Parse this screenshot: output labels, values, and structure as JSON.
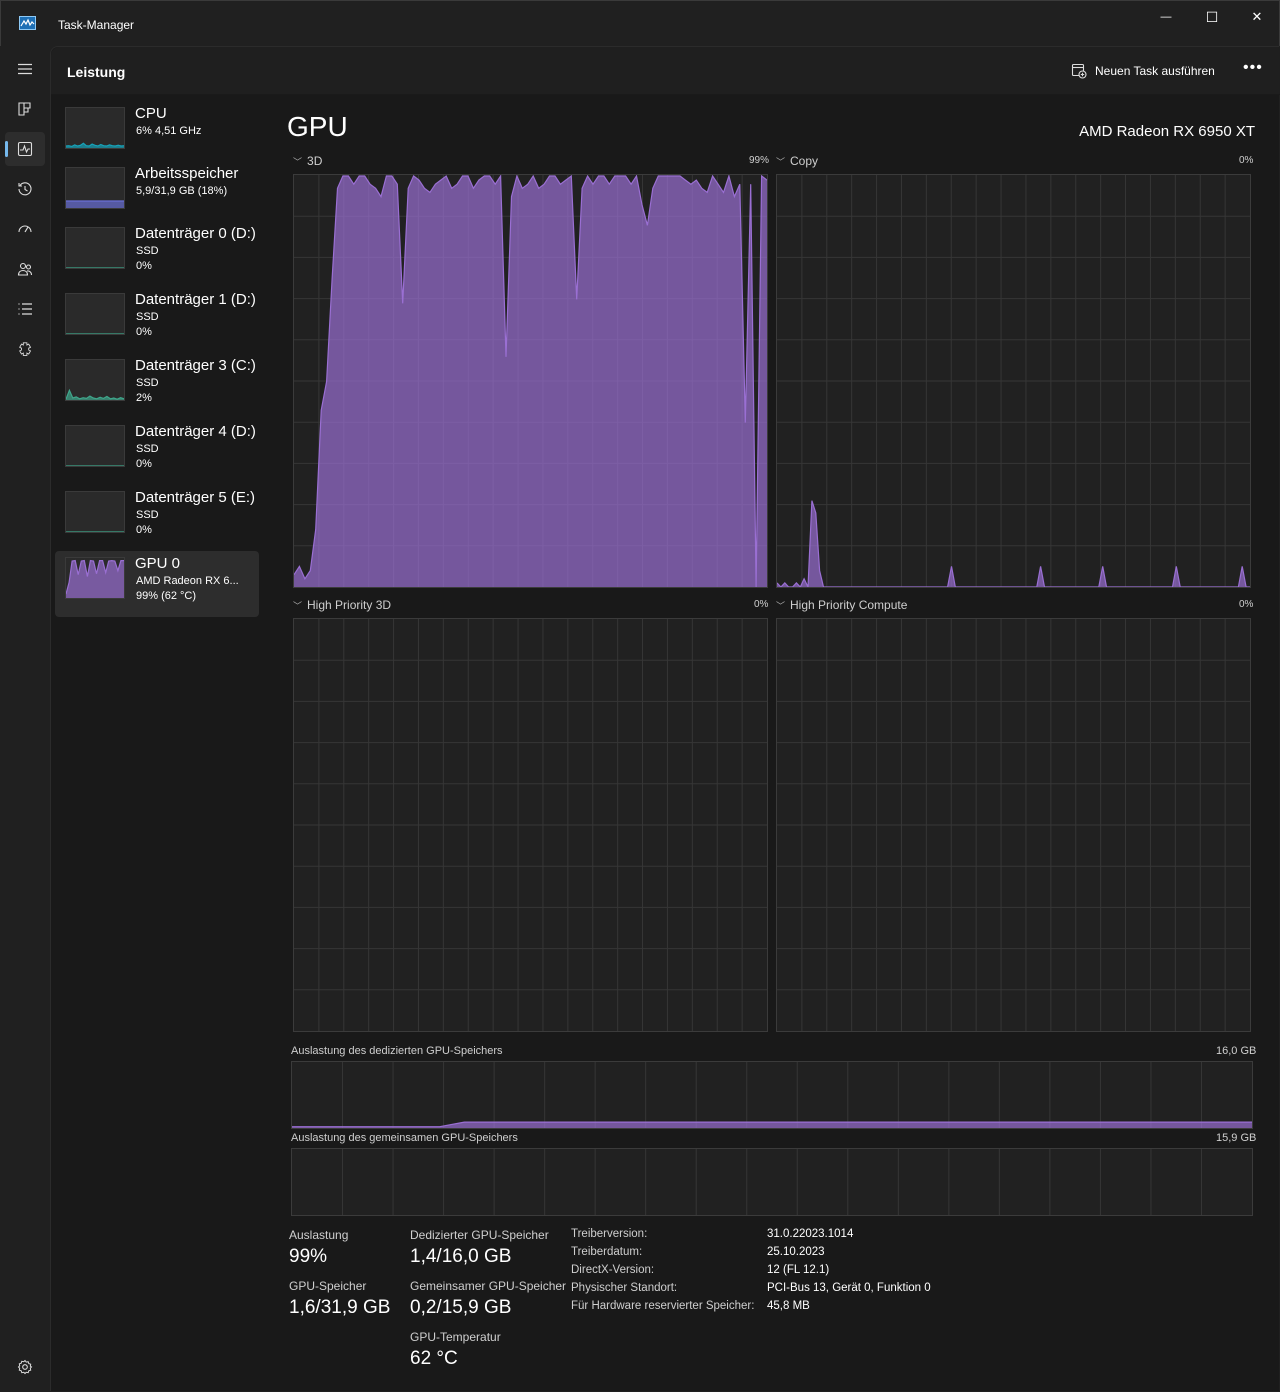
{
  "window": {
    "title": "Task-Manager",
    "minimize_glyph": "—",
    "maximize_glyph": "☐",
    "close_glyph": "✕"
  },
  "nav": {
    "items": [
      {
        "icon": "hamburger-menu-icon"
      },
      {
        "icon": "processes-icon"
      },
      {
        "icon": "performance-icon",
        "active": true
      },
      {
        "icon": "app-history-icon"
      },
      {
        "icon": "startup-apps-icon"
      },
      {
        "icon": "users-icon"
      },
      {
        "icon": "details-icon"
      },
      {
        "icon": "services-icon"
      }
    ],
    "settings_icon": "settings-gear-icon"
  },
  "header": {
    "title": "Leistung",
    "run_task_label": "Neuen Task ausführen",
    "more_label": "•••"
  },
  "devices": [
    {
      "name": "CPU",
      "line1": "6% 4,51 GHz",
      "line2": "",
      "color": "#17a2b8",
      "series": [
        0.05,
        0.06,
        0.04,
        0.08,
        0.05,
        0.07,
        0.12,
        0.06,
        0.05,
        0.1,
        0.07,
        0.05,
        0.09,
        0.06,
        0.05,
        0.08,
        0.06,
        0.05,
        0.07,
        0.05,
        0.06
      ]
    },
    {
      "name": "Arbeitsspeicher",
      "line1": "5,9/31,9 GB (18%)",
      "line2": "",
      "color": "#6a6fd6",
      "series": [
        0.18,
        0.18,
        0.18,
        0.18,
        0.18,
        0.18,
        0.18,
        0.18,
        0.18,
        0.18,
        0.18,
        0.18
      ]
    },
    {
      "name": "Datenträger 0 (D:)",
      "line1": "SSD",
      "line2": "0%",
      "color": "#3fa68b",
      "series": [
        0,
        0,
        0,
        0,
        0,
        0,
        0,
        0,
        0,
        0
      ]
    },
    {
      "name": "Datenträger 1 (D:)",
      "line1": "SSD",
      "line2": "0%",
      "color": "#3fa68b",
      "series": [
        0,
        0,
        0,
        0,
        0,
        0,
        0,
        0,
        0,
        0
      ]
    },
    {
      "name": "Datenträger 3 (C:)",
      "line1": "SSD",
      "line2": "2%",
      "color": "#3fa68b",
      "series": [
        0.02,
        0.25,
        0.05,
        0.08,
        0.03,
        0.06,
        0.04,
        0.1,
        0.05,
        0.03,
        0.07,
        0.04,
        0.09,
        0.03,
        0.05,
        0.02,
        0.06,
        0.03
      ]
    },
    {
      "name": "Datenträger 4 (D:)",
      "line1": "SSD",
      "line2": "0%",
      "color": "#3fa68b",
      "series": [
        0,
        0,
        0,
        0,
        0,
        0,
        0,
        0,
        0,
        0
      ]
    },
    {
      "name": "Datenträger 5 (E:)",
      "line1": "SSD",
      "line2": "0%",
      "color": "#3fa68b",
      "series": [
        0,
        0,
        0,
        0,
        0,
        0,
        0,
        0,
        0,
        0
      ]
    },
    {
      "name": "GPU 0",
      "line1": "AMD Radeon RX 6...",
      "line2": "99% (62 °C)",
      "color": "#9a6fd3",
      "selected": true,
      "series": [
        0.1,
        0.4,
        0.95,
        0.96,
        0.6,
        0.95,
        0.96,
        0.55,
        0.96,
        0.95,
        0.62,
        0.96,
        0.96,
        0.65,
        0.95,
        0.96,
        0.95,
        0.7,
        0.96,
        0.96
      ]
    }
  ],
  "gpu": {
    "title": "GPU",
    "model": "AMD Radeon RX 6950 XT",
    "accent": "#9a6fd3",
    "engines": [
      {
        "name": "3D",
        "percent": "99%",
        "series": [
          0.03,
          0.05,
          0.02,
          0.04,
          0.14,
          0.43,
          0.5,
          0.75,
          0.97,
          1.0,
          1.0,
          0.98,
          1.0,
          1.0,
          0.98,
          0.97,
          0.95,
          1.0,
          1.0,
          0.98,
          0.69,
          0.97,
          1.0,
          0.99,
          0.97,
          0.96,
          0.98,
          0.99,
          1.0,
          0.97,
          0.98,
          1.0,
          1.0,
          0.97,
          0.99,
          1.0,
          1.0,
          0.98,
          1.0,
          0.56,
          0.95,
          1.0,
          0.97,
          0.98,
          1.0,
          0.97,
          0.98,
          1.0,
          1.0,
          0.98,
          0.99,
          1.0,
          0.7,
          0.97,
          1.0,
          0.98,
          1.0,
          1.0,
          0.98,
          1.0,
          1.0,
          1.0,
          0.98,
          1.0,
          0.93,
          0.88,
          0.97,
          1.0,
          1.0,
          1.0,
          1.0,
          1.0,
          0.99,
          0.98,
          0.99,
          0.97,
          0.96,
          1.0,
          0.98,
          0.96,
          1.0,
          0.95,
          0.98,
          0.4,
          0.98,
          0.0,
          1.0,
          0.99
        ]
      },
      {
        "name": "Copy",
        "percent": "0%",
        "series": [
          0.01,
          0.0,
          0.01,
          0.0,
          0.0,
          0.01,
          0.0,
          0.02,
          0.0,
          0.21,
          0.18,
          0.04,
          0.0,
          0.0,
          0.0,
          0.0,
          0.0,
          0.0,
          0.0,
          0.0,
          0.0,
          0.0,
          0.0,
          0.0,
          0.0,
          0.0,
          0.0,
          0.0,
          0.0,
          0.0,
          0.0,
          0.0,
          0.0,
          0.0,
          0.0,
          0.0,
          0.0,
          0.0,
          0.0,
          0.0,
          0.0,
          0.0,
          0.0,
          0.0,
          0.0,
          0.05,
          0.0,
          0.0,
          0.0,
          0.0,
          0.0,
          0.0,
          0.0,
          0.0,
          0.0,
          0.0,
          0.0,
          0.0,
          0.0,
          0.0,
          0.0,
          0.0,
          0.0,
          0.0,
          0.0,
          0.0,
          0.0,
          0.0,
          0.05,
          0.0,
          0.0,
          0.0,
          0.0,
          0.0,
          0.0,
          0.0,
          0.0,
          0.0,
          0.0,
          0.0,
          0.0,
          0.0,
          0.0,
          0.0,
          0.05,
          0.0,
          0.0,
          0.0,
          0.0,
          0.0,
          0.0,
          0.0,
          0.0,
          0.0,
          0.0,
          0.0,
          0.0,
          0.0,
          0.0,
          0.0,
          0.0,
          0.0,
          0.0,
          0.05,
          0.0,
          0.0,
          0.0,
          0.0,
          0.0,
          0.0,
          0.0,
          0.0,
          0.0,
          0.0,
          0.0,
          0.0,
          0.0,
          0.0,
          0.0,
          0.0,
          0.05,
          0.0,
          0.0
        ]
      },
      {
        "name": "High Priority 3D",
        "percent": "0%",
        "series": []
      },
      {
        "name": "High Priority Compute",
        "percent": "0%",
        "series": []
      }
    ],
    "dedicated_mem": {
      "label": "Auslastung des dedizierten GPU-Speichers",
      "max": "16,0 GB",
      "series": [
        0.02,
        0.02,
        0.02,
        0.02,
        0.02,
        0.02,
        0.02,
        0.09,
        0.09,
        0.09,
        0.09,
        0.09,
        0.09,
        0.09,
        0.09,
        0.09,
        0.09,
        0.09,
        0.09,
        0.09,
        0.09,
        0.09,
        0.09,
        0.09,
        0.09,
        0.09,
        0.09,
        0.09,
        0.09,
        0.09,
        0.09,
        0.09,
        0.09,
        0.09,
        0.09,
        0.09,
        0.09,
        0.09,
        0.09,
        0.09
      ]
    },
    "shared_mem": {
      "label": "Auslastung des gemeinsamen GPU-Speichers",
      "max": "15,9 GB",
      "series": []
    },
    "stats": {
      "utilization_label": "Auslastung",
      "utilization_value": "99%",
      "dedicated_label": "Dedizierter GPU-Speicher",
      "dedicated_value": "1,4/16,0 GB",
      "gpu_mem_label": "GPU-Speicher",
      "gpu_mem_value": "1,6/31,9 GB",
      "shared_label": "Gemeinsamer GPU-Speicher",
      "shared_value": "0,2/15,9 GB",
      "temp_label": "GPU-Temperatur",
      "temp_value": "62 °C"
    },
    "info": [
      {
        "key": "Treiberversion:",
        "value": "31.0.22023.1014"
      },
      {
        "key": "Treiberdatum:",
        "value": "25.10.2023"
      },
      {
        "key": "DirectX-Version:",
        "value": "12 (FL 12.1)"
      },
      {
        "key": "Physischer Standort:",
        "value": "PCI-Bus 13, Gerät 0, Funktion 0"
      },
      {
        "key": "Für Hardware reservierter Speicher:",
        "value": "45,8 MB"
      }
    ]
  }
}
